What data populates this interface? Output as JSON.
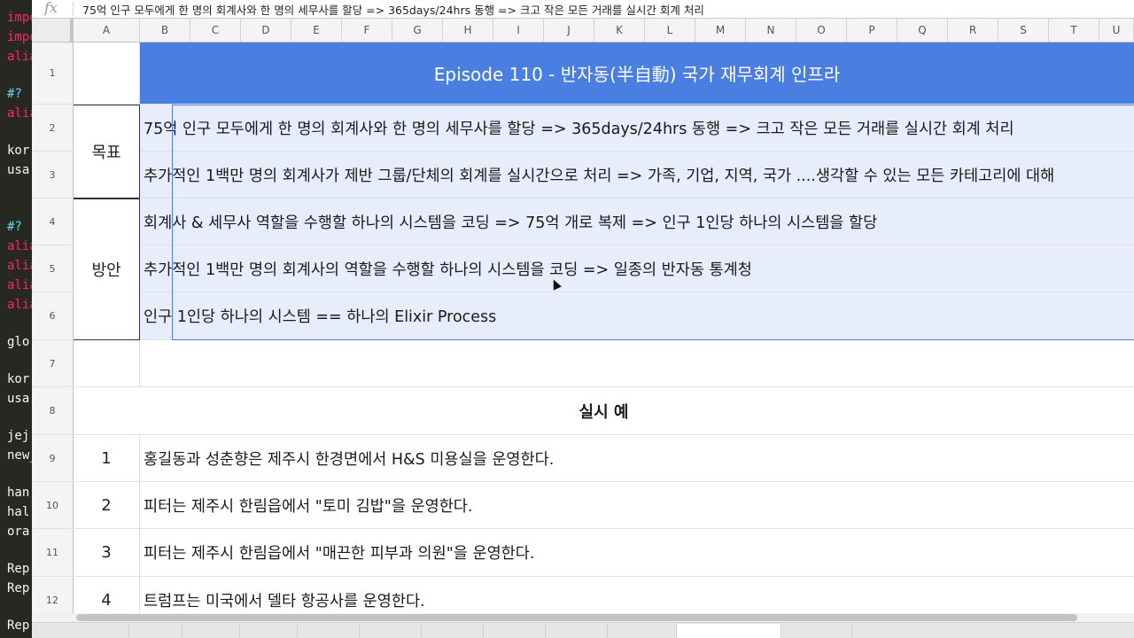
{
  "editor": {
    "lines": [
      {
        "text": "impo",
        "color": "#f92672"
      },
      {
        "text": "impo",
        "color": "#f92672"
      },
      {
        "text": "alia",
        "color": "#f92672"
      },
      {
        "text": "#?",
        "color": "#66d9ef"
      },
      {
        "text": "alia",
        "color": "#f92672"
      },
      {
        "text": "kor",
        "color": "#f8f8f2"
      },
      {
        "text": "usa",
        "color": "#f8f8f2"
      },
      {
        "text": "#?",
        "color": "#66d9ef"
      },
      {
        "text": "alia",
        "color": "#f92672"
      },
      {
        "text": "alia",
        "color": "#f92672"
      },
      {
        "text": "alia",
        "color": "#f92672"
      },
      {
        "text": "alia",
        "color": "#f92672"
      },
      {
        "text": "glo",
        "color": "#f8f8f2"
      },
      {
        "text": "kor",
        "color": "#f8f8f2"
      },
      {
        "text": "usa",
        "color": "#f8f8f2"
      },
      {
        "text": "jej",
        "color": "#f8f8f2"
      },
      {
        "text": "new_",
        "color": "#f8f8f2"
      },
      {
        "text": "han",
        "color": "#f8f8f2"
      },
      {
        "text": "hal",
        "color": "#f8f8f2"
      },
      {
        "text": "ora",
        "color": "#f8f8f2"
      },
      {
        "text": "Rep",
        "color": "#f8f8f2"
      },
      {
        "text": "Rep",
        "color": "#f8f8f2"
      },
      {
        "text": "Rep",
        "color": "#f8f8f2"
      }
    ]
  },
  "formula_bar": {
    "fx_label": "fx",
    "content": "75억 인구 모두에게 한 명의 회계사와 한 명의 세무사를 할당 => 365days/24hrs 동행 => 크고 작은 모든 거래를 실시간 회계 처리"
  },
  "columns": [
    "A",
    "B",
    "C",
    "D",
    "E",
    "F",
    "G",
    "H",
    "I",
    "J",
    "K",
    "L",
    "M",
    "N",
    "O",
    "P",
    "Q",
    "R",
    "S",
    "T",
    "U"
  ],
  "rows": {
    "r1": {
      "num": "1",
      "title": "Episode 110 - 반자동(半自動) 국가 재무회계 인프라"
    },
    "r2": {
      "num": "2",
      "text": "75억 인구 모두에게 한 명의 회계사와 한 명의 세무사를 할당 => 365days/24hrs 동행 => 크고 작은 모든 거래를 실시간 회계 처리"
    },
    "r3": {
      "num": "3",
      "text": "추가적인 1백만 명의 회계사가 제반 그룹/단체의 회계를 실시간으로 처리 => 가족, 기업, 지역, 국가 ....생각할 수 있는 모든 카테고리에 대해"
    },
    "r4": {
      "num": "4",
      "text": "회계사 & 세무사 역할을 수행할 하나의 시스템을 코딩 => 75억 개로 복제 => 인구 1인당 하나의 시스템을 할당"
    },
    "r5": {
      "num": "5",
      "text": "추가적인 1백만 명의 회계사의 역할을 수행할 하나의 시스템을 코딩 => 일종의 반자동 통계청"
    },
    "r6": {
      "num": "6",
      "text": "인구 1인당 하나의 시스템 == 하나의 Elixir Process"
    },
    "r7": {
      "num": "7"
    },
    "r8": {
      "num": "8",
      "text": "실시 예"
    },
    "r9": {
      "num": "9",
      "a": "1",
      "text": "홍길동과 성춘향은 제주시 한경면에서 H&S 미용실을 운영한다."
    },
    "r10": {
      "num": "10",
      "a": "2",
      "text": "피터는 제주시 한림읍에서 \"토미 김밥\"을 운영한다."
    },
    "r11": {
      "num": "11",
      "a": "3",
      "text": "피터는 제주시 한림읍에서 \"매끈한 피부과 의원\"을 운영한다."
    },
    "r12": {
      "num": "12",
      "a": "4",
      "text": "트럼프는 미국에서 델타 항공사를 운영한다."
    }
  },
  "groups": {
    "goal": "목표",
    "method": "방안"
  },
  "colors": {
    "title_bg": "#4a7ee0",
    "highlight_bg": "#e8edfb",
    "editor_bg": "#272822"
  }
}
